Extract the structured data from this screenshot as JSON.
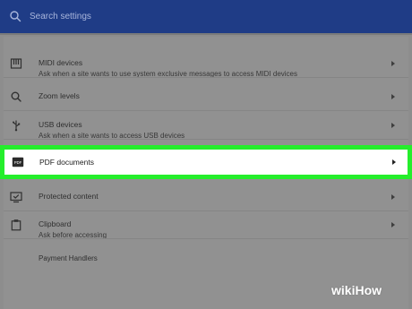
{
  "search": {
    "placeholder": "Search settings",
    "icon": "search-icon"
  },
  "items": [
    {
      "title": "MIDI devices",
      "subtitle": "Ask when a site wants to use system exclusive messages to access MIDI devices",
      "icon": "midi-device-icon"
    },
    {
      "title": "Zoom levels",
      "subtitle": "",
      "icon": "zoom-icon"
    },
    {
      "title": "USB devices",
      "subtitle": "Ask when a site wants to access USB devices",
      "icon": "usb-icon"
    },
    {
      "title": "PDF documents",
      "subtitle": "",
      "icon": "pdf-icon"
    },
    {
      "title": "Protected content",
      "subtitle": "",
      "icon": "monitor-check-icon"
    },
    {
      "title": "Clipboard",
      "subtitle": "Ask before accessing",
      "icon": "clipboard-icon"
    },
    {
      "title": "Payment Handlers",
      "subtitle": "",
      "icon": ""
    }
  ],
  "watermark": {
    "wiki": "wiki",
    "how": "How"
  },
  "colors": {
    "topbar": "#1f3c86",
    "highlight": "#25ee2c",
    "panel": "#919191"
  }
}
